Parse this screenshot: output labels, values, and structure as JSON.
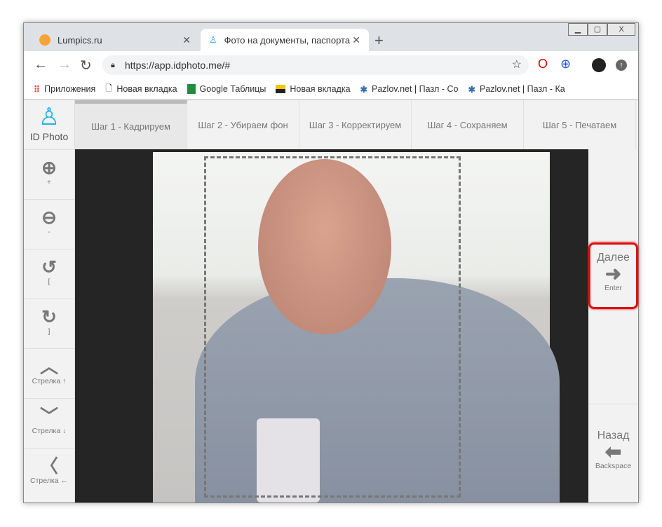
{
  "browser": {
    "tabs": [
      {
        "title": "Lumpics.ru",
        "active": false
      },
      {
        "title": "Фото на документы, паспорта, з",
        "active": true
      }
    ],
    "url": "https://app.idphoto.me/#",
    "bookmarks": [
      "Приложения",
      "Новая вкладка",
      "Google Таблицы",
      "Новая вкладка",
      "Pazlov.net | Пазл - Со",
      "Pazlov.net | Пазл - Ка"
    ]
  },
  "app": {
    "logo": "ID Photo",
    "tools": [
      {
        "icon": "zoom-in",
        "key": "+"
      },
      {
        "icon": "zoom-out",
        "key": "-"
      },
      {
        "icon": "rotate-left",
        "key": "["
      },
      {
        "icon": "rotate-right",
        "key": "]"
      },
      {
        "icon": "arrow-up",
        "key": "Стрелка ↑"
      },
      {
        "icon": "arrow-down",
        "key": "Стрелка ↓"
      },
      {
        "icon": "arrow-left",
        "key": "Стрелка ←"
      }
    ],
    "steps": [
      "Шаг 1 - Кадрируем",
      "Шаг 2 - Убираем фон",
      "Шаг 3 - Корректируем",
      "Шаг 4 - Сохраняем",
      "Шаг 5 - Печатаем"
    ],
    "active_step": 0,
    "next": {
      "label": "Далее",
      "key": "Enter"
    },
    "back": {
      "label": "Назад",
      "key": "Backspace"
    },
    "highlight_color": "#dd1111"
  }
}
